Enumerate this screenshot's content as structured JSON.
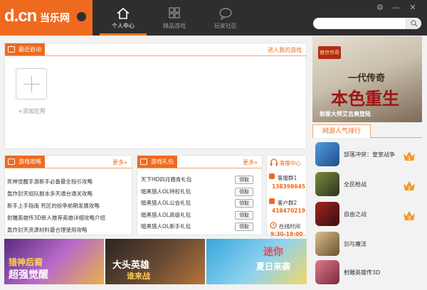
{
  "logo": {
    "dcn": "d.cn",
    "text": "当乐网"
  },
  "nav": [
    {
      "label": "个人中心",
      "icon": "home-icon",
      "active": true
    },
    {
      "label": "精品游戏",
      "icon": "grid-icon",
      "active": false
    },
    {
      "label": "玩家社区",
      "icon": "chat-bubble-icon",
      "active": false
    }
  ],
  "recent": {
    "title": "最近启动",
    "more": "进入我的游戏",
    "add_label": "+添加应用"
  },
  "guides": {
    "title": "游戏攻略",
    "more": "更多»",
    "items": [
      "死神觉醒手游新手必备最全指引攻略",
      "轰炸封天组队副本多天通台通关攻略",
      "新手上手指南 死区的纷争前期发展攻略",
      "射雕英雄传3D新人推荐英雄详细攻略介绍",
      "轰炸封天资源材料最合理使用攻略"
    ]
  },
  "gifts": {
    "title": "游戏礼包",
    "more": "更多»",
    "items": [
      "天下HD四月踏青礼包",
      "暗黑猎人OL特权礼包",
      "暗黑猎人OL公会礼包",
      "暗黑猎人OL高级礼包",
      "暗黑猎人OL新手礼包"
    ],
    "button": "领取"
  },
  "service": {
    "title": "客服中心",
    "phone_label": "客服群1",
    "phone": "138398645",
    "qq_label": "客户群2",
    "qq": "418470219",
    "online_label": "在线时间",
    "hours": "9:30-19:00"
  },
  "ad": {
    "logo": "傲世传奇",
    "line1": "一代传奇",
    "line2": "本色重生",
    "line3": "刺客大师艾吉奥登陆"
  },
  "hot": {
    "title": "网游人气排行",
    "items": [
      {
        "name": "部落冲突：皇室战争",
        "rank": "1",
        "color": "#3a7fcf"
      },
      {
        "name": "全民枪战",
        "rank": "2",
        "color": "#556b2f"
      },
      {
        "name": "自由之战",
        "rank": "3",
        "color": "#7a1d1d"
      },
      {
        "name": "剑与魔法",
        "rank": "",
        "color": "#b08f5a"
      },
      {
        "name": "射雕英雄传3D",
        "rank": "",
        "color": "#c04a5a"
      }
    ]
  },
  "banners": [
    {
      "text1": "猎神后裔",
      "text2": "超强觉醒",
      "colors": [
        "#7b3fa0",
        "#e0a040"
      ]
    },
    {
      "text1": "大头英雄",
      "text2": "谁来战",
      "colors": [
        "#2f2a26",
        "#a35a2c"
      ]
    },
    {
      "text1": "迷你",
      "text2": "夏日来袭",
      "colors": [
        "#3ab0e0",
        "#f2d060"
      ]
    }
  ]
}
